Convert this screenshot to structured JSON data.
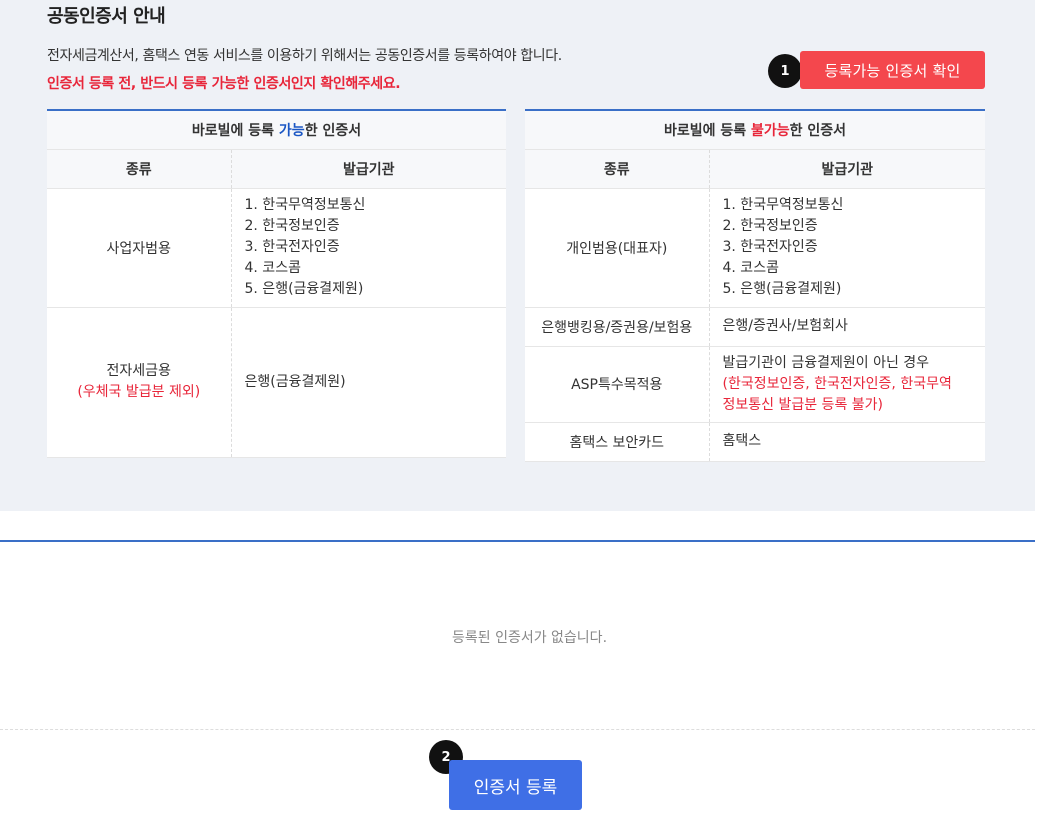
{
  "title": "공동인증서 안내",
  "description": "전자세금계산서, 홈택스 연동 서비스를 이용하기 위해서는 공동인증서를 등록하여야 합니다.",
  "warning": "인증서 등록 전, 반드시 등록 가능한 인증서인지 확인해주세요.",
  "step1": "1",
  "step2": "2",
  "check_button": "등록가능 인증서 확인",
  "register_button": "인증서 등록",
  "empty_message": "등록된 인증서가 없습니다.",
  "available_table": {
    "caption_pre": "바로빌에 등록 ",
    "caption_hl": "가능",
    "caption_post": "한 인증서",
    "col_kind": "종류",
    "col_issuer": "발급기관",
    "row1_kind": "사업자범용",
    "row1_issuers": [
      "1. 한국무역정보통신",
      "2. 한국정보인증",
      "3. 한국전자인증",
      "4. 코스콤",
      "5. 은행(금융결제원)"
    ],
    "row2_kind": "전자세금용",
    "row2_note": "(우체국 발급분 제외)",
    "row2_issuer": "은행(금융결제원)"
  },
  "unavailable_table": {
    "caption_pre": "바로빌에 등록 ",
    "caption_hl": "불가능",
    "caption_post": "한 인증서",
    "col_kind": "종류",
    "col_issuer": "발급기관",
    "row1_kind": "개인범용(대표자)",
    "row1_issuers": [
      "1. 한국무역정보통신",
      "2. 한국정보인증",
      "3. 한국전자인증",
      "4. 코스콤",
      "5. 은행(금융결제원)"
    ],
    "row2_kind": "은행뱅킹용/증권용/보험용",
    "row2_issuer": "은행/증권사/보험회사",
    "row3_kind": "ASP특수목적용",
    "row3_issuer": "발급기관이 금융결제원이 아닌 경우",
    "row3_note_1": "(한국정보인증, 한국전자인증, 한국무역",
    "row3_note_2": "정보통신 발급분 등록 불가)",
    "row4_kind": "홈택스 보안카드",
    "row4_issuer": "홈택스"
  },
  "colors": {
    "accent_blue": "#3f6fe6",
    "accent_red": "#f4474d",
    "warning_red": "#e8263a",
    "panel_bg": "#eef1f6"
  }
}
